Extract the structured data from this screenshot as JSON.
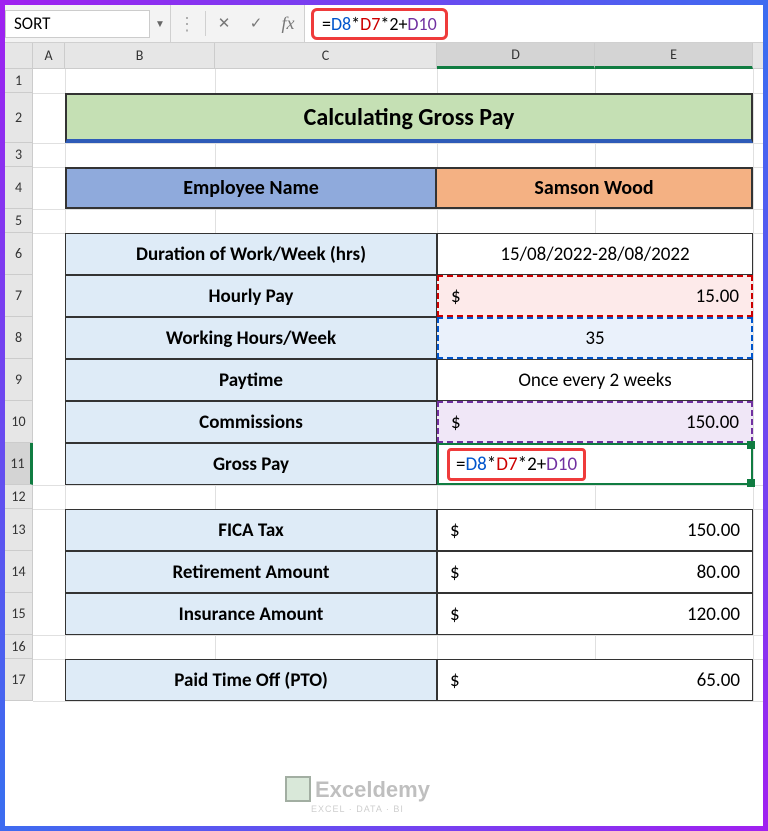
{
  "name_box": "SORT",
  "formula_bar": {
    "eq": "=",
    "d8": "D8",
    "star1": "*",
    "d7": "D7",
    "star2": "*",
    "two": "2",
    "plus": "+",
    "d10": "D10"
  },
  "columns": {
    "A": "A",
    "B": "B",
    "C": "C",
    "D": "D",
    "E": "E"
  },
  "rows": {
    "r1": "1",
    "r2": "2",
    "r3": "3",
    "r4": "4",
    "r5": "5",
    "r6": "6",
    "r7": "7",
    "r8": "8",
    "r9": "9",
    "r10": "10",
    "r11": "11",
    "r12": "12",
    "r13": "13",
    "r14": "14",
    "r15": "15",
    "r16": "16",
    "r17": "17"
  },
  "title": "Calculating Gross Pay",
  "employee": {
    "label": "Employee Name",
    "value": "Samson Wood"
  },
  "table1": {
    "duration_label": "Duration of Work/Week (hrs)",
    "duration_value": "15/08/2022-28/08/2022",
    "hourly_label": "Hourly Pay",
    "hourly_currency": "$",
    "hourly_value": "15.00",
    "hours_label": "Working Hours/Week",
    "hours_value": "35",
    "paytime_label": "Paytime",
    "paytime_value": "Once every 2 weeks",
    "commissions_label": "Commissions",
    "commissions_currency": "$",
    "commissions_value": "150.00",
    "gross_label": "Gross Pay",
    "gross_formula_eq": "=",
    "gross_formula_d8": "D8",
    "gross_formula_s1": "*",
    "gross_formula_d7": "D7",
    "gross_formula_s2": "*",
    "gross_formula_two": "2",
    "gross_formula_plus": "+",
    "gross_formula_d10": "D10"
  },
  "table2": {
    "fica_label": "FICA Tax",
    "fica_currency": "$",
    "fica_value": "150.00",
    "retire_label": "Retirement Amount",
    "retire_currency": "$",
    "retire_value": "80.00",
    "insurance_label": "Insurance Amount",
    "insurance_currency": "$",
    "insurance_value": "120.00"
  },
  "table3": {
    "pto_label": "Paid Time Off (PTO)",
    "pto_currency": "$",
    "pto_value": "65.00"
  },
  "watermark": {
    "main": "Exceldemy",
    "sub": "EXCEL · DATA · BI"
  }
}
